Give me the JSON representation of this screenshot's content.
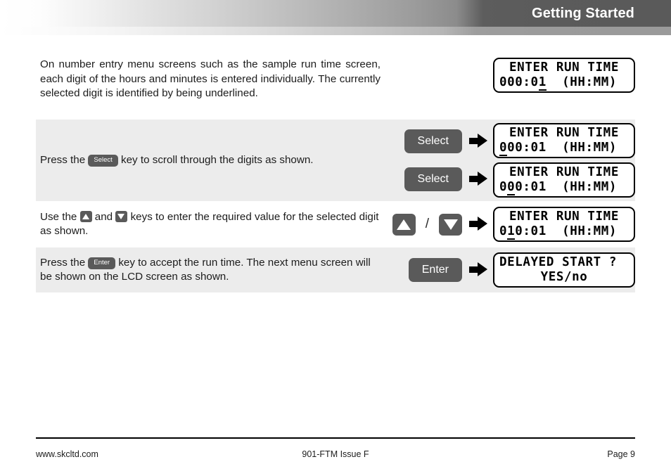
{
  "header": {
    "title": "Getting Started"
  },
  "rows": [
    {
      "text_before": "On number entry menu screens such as the sample run time screen, each digit of the hours and minutes is entered individually. The currently selected digit is identified by being underlined.",
      "shaded": false
    },
    {
      "text_before": "Press the ",
      "inline_key": "Select",
      "text_after": " key to scroll through the digits as shown.",
      "shaded": true,
      "key_label": "Select",
      "key_label2": "Select"
    },
    {
      "text_before": "Use the ",
      "text_mid": " and ",
      "text_after": " keys to enter the required value for the selected digit as shown.",
      "shaded": false,
      "separator": "/"
    },
    {
      "text_before": "Press the ",
      "inline_key": "Enter",
      "text_after": " key to accept the run time. The next menu screen will be shown on the LCD screen as shown.",
      "shaded": true,
      "key_label": "Enter"
    }
  ],
  "lcd": {
    "screen1": {
      "line1": "ENTER RUN TIME",
      "line2_pre": "000:0",
      "line2_underlined": "1",
      "line2_post": "  (HH:MM)"
    },
    "screen2": {
      "line1": "ENTER RUN TIME",
      "line2_pre": "",
      "line2_underlined": "0",
      "line2_post": "00:01  (HH:MM)"
    },
    "screen3": {
      "line1": "ENTER RUN TIME",
      "line2_pre": "0",
      "line2_underlined": "0",
      "line2_post": "0:01  (HH:MM)"
    },
    "screen4": {
      "line1": "ENTER RUN TIME",
      "line2_pre": "0",
      "line2_underlined": "1",
      "line2_post": "0:01  (HH:MM)"
    },
    "screen5": {
      "line1": "DELAYED START ?",
      "line2": "YES/no"
    }
  },
  "icons": {
    "arrow_right": "arrow-right-icon",
    "triangle_up": "triangle-up-icon",
    "triangle_down": "triangle-down-icon"
  },
  "footer": {
    "left": "www.skcltd.com",
    "center": "901-FTM Issue F",
    "right": "Page 9"
  }
}
